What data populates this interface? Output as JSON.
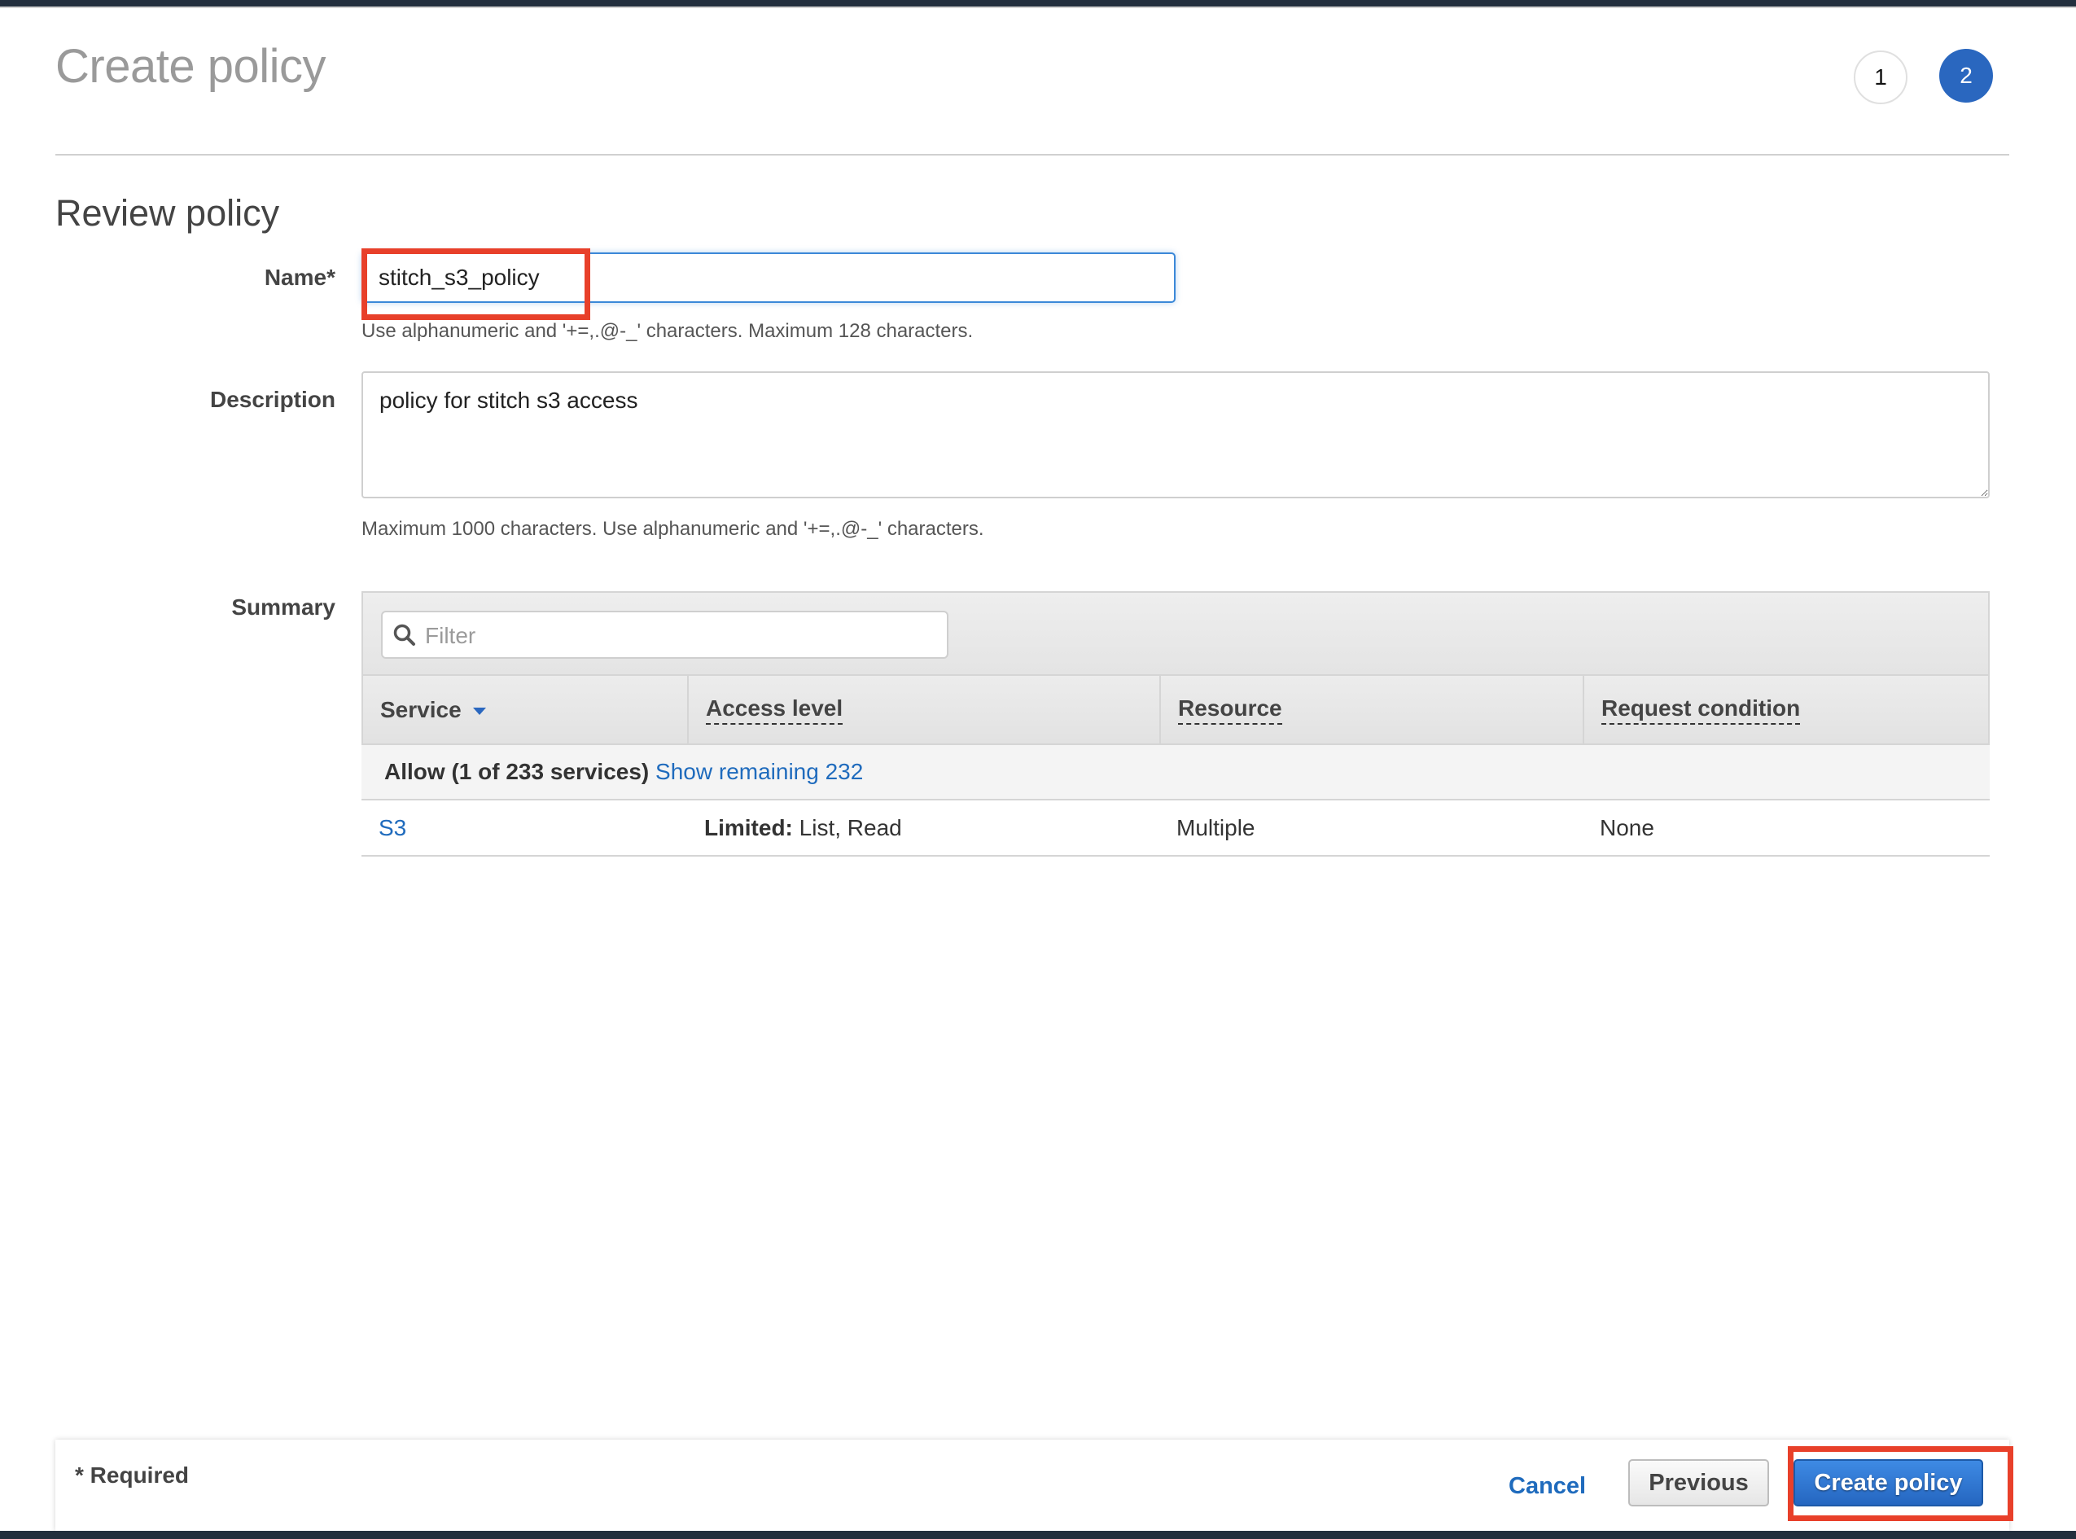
{
  "header": {
    "title": "Create policy",
    "steps": [
      {
        "label": "1",
        "state": "completed"
      },
      {
        "label": "2",
        "state": "active"
      }
    ]
  },
  "section": {
    "title": "Review policy"
  },
  "form": {
    "name": {
      "label": "Name*",
      "value": "stitch_s3_policy",
      "hint": "Use alphanumeric and '+=,.@-_' characters. Maximum 128 characters."
    },
    "description": {
      "label": "Description",
      "value": "policy for stitch s3 access",
      "hint": "Maximum 1000 characters. Use alphanumeric and '+=,.@-_' characters."
    },
    "summary": {
      "label": "Summary",
      "filter_placeholder": "Filter",
      "columns": [
        "Service",
        "Access level",
        "Resource",
        "Request condition"
      ],
      "group": {
        "label": "Allow (1 of 233 services)",
        "link": "Show remaining 232"
      },
      "rows": [
        {
          "service": "S3",
          "access_level_prefix": "Limited:",
          "access_level": " List, Read",
          "resource": "Multiple",
          "request_condition": "None"
        }
      ]
    }
  },
  "footer": {
    "required_note": "* Required",
    "cancel_label": "Cancel",
    "previous_label": "Previous",
    "create_label": "Create policy"
  },
  "colors": {
    "accent": "#2a67bf",
    "link": "#1f6bbd",
    "highlight": "#e8402a",
    "topbar": "#232f3e"
  }
}
